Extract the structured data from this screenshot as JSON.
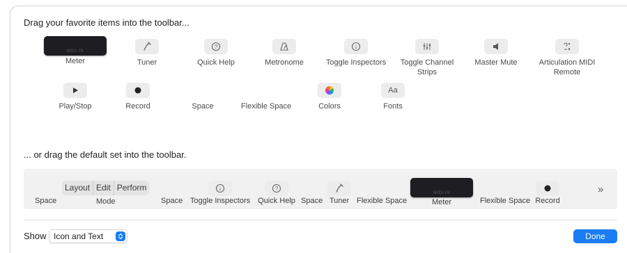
{
  "headings": {
    "favorites": "Drag your favorite items into the toolbar...",
    "default_set": "... or drag the default set into the toolbar."
  },
  "favorite_items": {
    "meter": {
      "label": "Meter",
      "display_text": "MIDI IN",
      "icon": "meter-display"
    },
    "tuner": {
      "label": "Tuner",
      "icon": "tuning-fork-icon",
      "glyph": "⟋"
    },
    "quick_help": {
      "label": "Quick Help",
      "icon": "question-circle-icon",
      "glyph": "?"
    },
    "metronome": {
      "label": "Metronome",
      "icon": "metronome-icon",
      "glyph": "⚠"
    },
    "toggle_inspectors": {
      "label": "Toggle Inspectors",
      "icon": "info-circle-icon",
      "glyph": "i"
    },
    "toggle_channel_strips": {
      "label": "Toggle Channel Strips",
      "icon": "sliders-icon",
      "glyph": "⫵"
    },
    "master_mute": {
      "label": "Master Mute",
      "icon": "speaker-icon",
      "glyph": "◀"
    },
    "articulation": {
      "label": "Articulation MIDI Remote",
      "icon": "articulation-icon",
      "glyph": "⋰"
    },
    "play_stop": {
      "label": "Play/Stop",
      "icon": "play-icon",
      "glyph": "▶"
    },
    "record": {
      "label": "Record",
      "icon": "record-icon",
      "glyph": "●"
    },
    "space": {
      "label": "Space"
    },
    "flexible_space": {
      "label": "Flexible Space"
    },
    "colors": {
      "label": "Colors",
      "icon": "color-wheel-icon"
    },
    "fonts": {
      "label": "Fonts",
      "icon": "fonts-icon",
      "glyph": "Aa"
    }
  },
  "default_set": {
    "space1": "Space",
    "mode_segments": [
      "Layout",
      "Edit",
      "Perform"
    ],
    "mode_label": "Mode",
    "space2": "Space",
    "toggle_inspectors": "Toggle Inspectors",
    "quick_help": "Quick Help",
    "space3": "Space",
    "tuner": "Tuner",
    "flexible_space1": "Flexible Space",
    "meter_label": "Meter",
    "meter_display": "MIDI IN",
    "flexible_space2": "Flexible Space",
    "record": "Record",
    "overflow": "»"
  },
  "footer": {
    "show_label": "Show",
    "show_value": "Icon and Text",
    "done_label": "Done"
  },
  "colors": {
    "accent": "#1b7cf3",
    "meter_bg": "#1d1d22",
    "strip_bg": "#f1f1f1"
  }
}
